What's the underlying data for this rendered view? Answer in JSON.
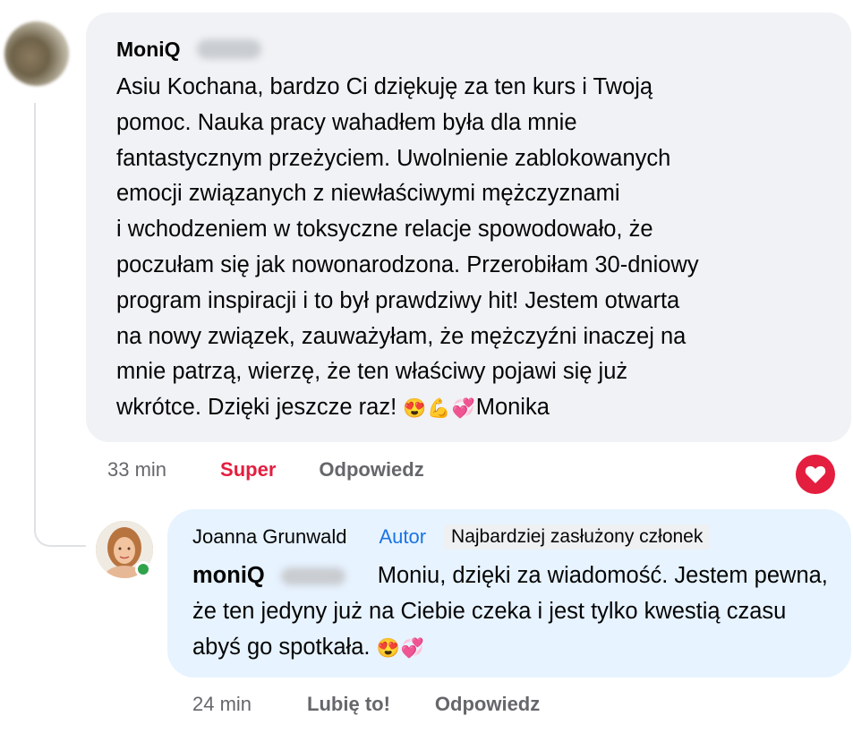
{
  "comment": {
    "author": "MoniQ",
    "text": "Asiu Kochana, bardzo Ci dziękuję za ten kurs i Twoją\npomoc. Nauka pracy wahadłem była dla mnie\nfantastycznym przeżyciem. Uwolnienie zablokowanych\nemocji związanych z niewłaściwymi mężczyznami\ni wchodzeniem w toksyczne relacje spowodowało, że\npoczułam się jak nowonarodzona. Przerobiłam 30-dniowy\nprogram inspiracji i to był prawdziwy hit! Jestem otwarta\nna nowy związek, zauważyłam, że mężczyźni inaczej na\nmnie patrzą, wierzę, że ten właściwy pojawi się już\nwkrótce. Dzięki jeszcze raz! ",
    "emojis": "😍💪💞",
    "signature": "Monika",
    "time": "33 min",
    "reaction_label": "Super",
    "reply_label": "Odpowiedz",
    "reaction_icon": "heart-icon",
    "reaction_color": "#e41e3f"
  },
  "reply": {
    "author": "Joanna Grunwald",
    "author_tag": "Autor",
    "badge": "Najbardziej zasłużony członek",
    "mention": "moniQ",
    "text": "Moniu, dzięki za wiadomość. Jestem pewna, że ten jedyny już na Ciebie czeka i jest tylko kwestią czasu abyś go spotkała.",
    "emojis": "😍💞",
    "time": "24 min",
    "like_label": "Lubię to!",
    "reply_label": "Odpowiedz",
    "online_color": "#31a24c"
  },
  "colors": {
    "comment_bubble": "#f0f2f5",
    "reply_bubble": "#e7f3ff",
    "author_tag": "#1b74e4",
    "muted": "#65676b"
  }
}
